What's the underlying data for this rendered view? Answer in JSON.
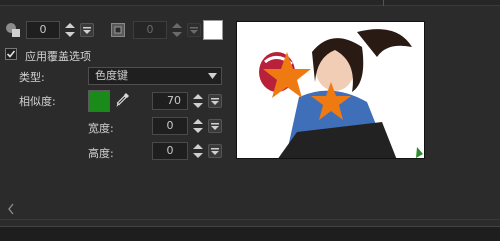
{
  "overlay_row": {
    "opacity_value": "0",
    "size_value": "0"
  },
  "apply_overlay": {
    "label": "应用覆盖选项",
    "checked": true
  },
  "type_field": {
    "label": "类型:",
    "value": "色度键"
  },
  "similarity": {
    "label": "相似度:",
    "value": "70",
    "color": "#1a8a1a"
  },
  "width_field": {
    "label": "宽度:",
    "value": "0"
  },
  "height_field": {
    "label": "高度:",
    "value": "0"
  },
  "icons": {
    "overlay": "layers-icon",
    "frame": "frame-icon",
    "eyedropper": "eyedropper-icon",
    "back": "chevron-left-icon"
  },
  "colors": {
    "panel_bg": "#2b2b2b",
    "star": "#f07a12"
  }
}
